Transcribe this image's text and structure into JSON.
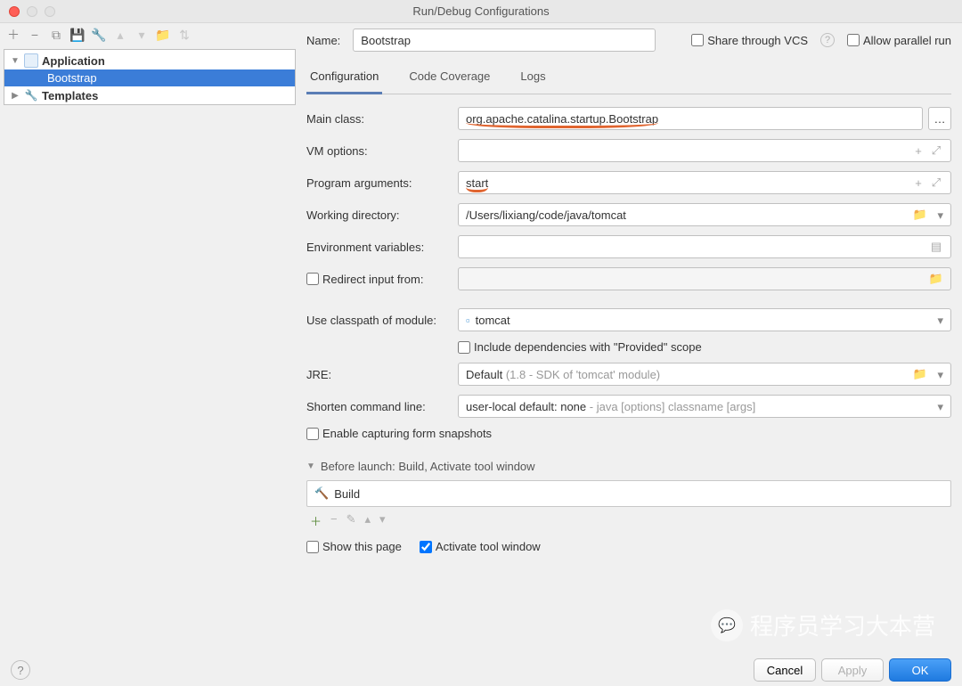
{
  "title": "Run/Debug Configurations",
  "sidebar": {
    "app_label": "Application",
    "selected": "Bootstrap",
    "templates": "Templates"
  },
  "name_label": "Name:",
  "name_value": "Bootstrap",
  "share_vcs": "Share through VCS",
  "allow_parallel": "Allow parallel run",
  "tabs": [
    "Configuration",
    "Code Coverage",
    "Logs"
  ],
  "labels": {
    "main_class": "Main class:",
    "vm_options": "VM options:",
    "prog_args": "Program arguments:",
    "work_dir": "Working directory:",
    "env_vars": "Environment variables:",
    "redirect": "Redirect input from:",
    "classpath": "Use classpath of module:",
    "include_deps": "Include dependencies with \"Provided\" scope",
    "jre": "JRE:",
    "shorten": "Shorten command line:",
    "enable_snap": "Enable capturing form snapshots"
  },
  "values": {
    "main_class": "org.apache.catalina.startup.Bootstrap",
    "vm_options": "",
    "prog_args": "start",
    "work_dir": "/Users/lixiang/code/java/tomcat",
    "env_vars": "",
    "classpath": "tomcat",
    "jre_main": "Default",
    "jre_grey": "(1.8 - SDK of 'tomcat' module)",
    "shorten_main": "user-local default: none",
    "shorten_grey": "- java [options] classname [args]"
  },
  "before_launch": {
    "header": "Before launch: Build, Activate tool window",
    "item": "Build",
    "show_page": "Show this page",
    "activate": "Activate tool window"
  },
  "buttons": {
    "cancel": "Cancel",
    "apply": "Apply",
    "ok": "OK"
  },
  "watermark": "程序员学习大本营"
}
